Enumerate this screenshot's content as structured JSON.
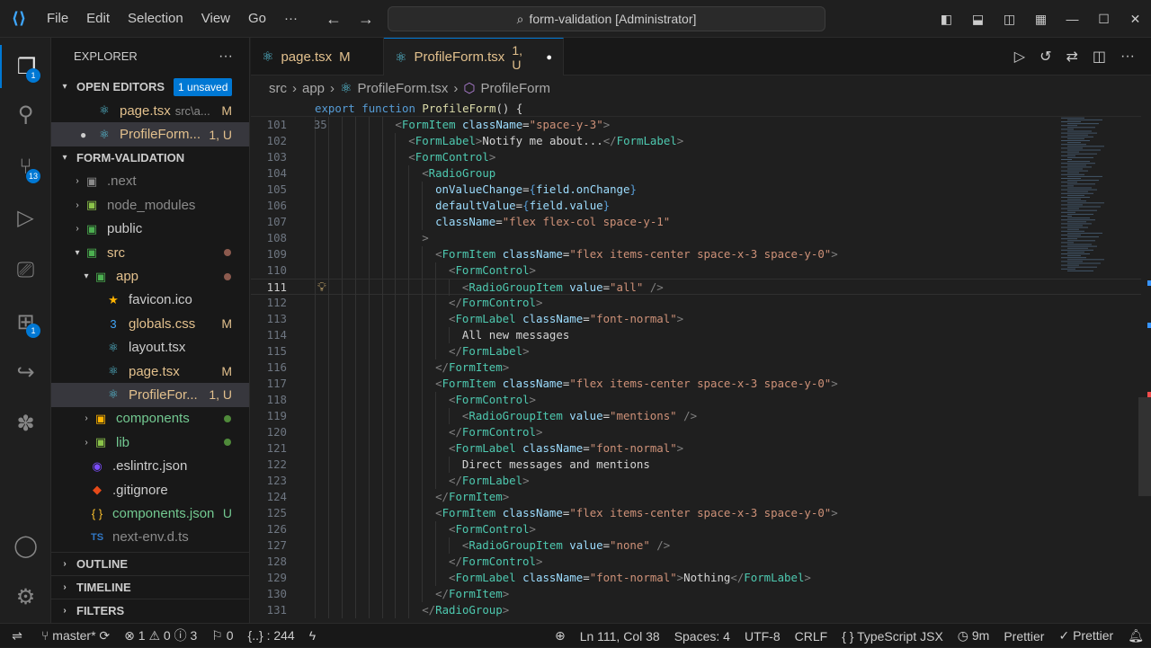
{
  "titlebar": {
    "menu": [
      "File",
      "Edit",
      "Selection",
      "View",
      "Go",
      "···"
    ],
    "search": "form-validation [Administrator]"
  },
  "activity": {
    "explorer_badge": "1",
    "scm_badge": "13",
    "extensions_badge": "1"
  },
  "explorer": {
    "title": "EXPLORER",
    "open_editors": "OPEN EDITORS",
    "unsaved": "1 unsaved",
    "open_files": [
      {
        "name": "page.tsx",
        "path": "src\\a...",
        "status": "M"
      },
      {
        "name": "ProfileForm...",
        "path": "",
        "status": "1, U"
      }
    ],
    "project": "FORM-VALIDATION",
    "tree": [
      {
        "name": ".next",
        "status": ""
      },
      {
        "name": "node_modules",
        "status": ""
      },
      {
        "name": "public",
        "status": ""
      },
      {
        "name": "src",
        "status": ""
      },
      {
        "name": "app",
        "status": ""
      },
      {
        "name": "favicon.ico",
        "status": ""
      },
      {
        "name": "globals.css",
        "status": "M"
      },
      {
        "name": "layout.tsx",
        "status": ""
      },
      {
        "name": "page.tsx",
        "status": "M"
      },
      {
        "name": "ProfileFor...",
        "status": "1, U"
      },
      {
        "name": "components",
        "status": ""
      },
      {
        "name": "lib",
        "status": ""
      },
      {
        "name": ".eslintrc.json",
        "status": ""
      },
      {
        "name": ".gitignore",
        "status": ""
      },
      {
        "name": "components.json",
        "status": "U"
      },
      {
        "name": "next-env.d.ts",
        "status": ""
      }
    ],
    "outline": "OUTLINE",
    "timeline": "TIMELINE",
    "filters": "FILTERS"
  },
  "tabs": [
    {
      "label": "page.tsx",
      "status": "M"
    },
    {
      "label": "ProfileForm.tsx",
      "status": "1, U"
    }
  ],
  "breadcrumb": [
    "src",
    "app",
    "ProfileForm.tsx",
    "ProfileForm"
  ],
  "sticky": {
    "num": "35",
    "code": "export function ProfileForm() {"
  },
  "lines": [
    {
      "n": "101",
      "i": 6,
      "c": "<FormItem className=\"space-y-3\">"
    },
    {
      "n": "102",
      "i": 7,
      "c": "<FormLabel>Notify me about...</FormLabel>"
    },
    {
      "n": "103",
      "i": 7,
      "c": "<FormControl>"
    },
    {
      "n": "104",
      "i": 8,
      "c": "<RadioGroup"
    },
    {
      "n": "105",
      "i": 9,
      "c": "onValueChange={field.onChange}"
    },
    {
      "n": "106",
      "i": 9,
      "c": "defaultValue={field.value}"
    },
    {
      "n": "107",
      "i": 9,
      "c": "className=\"flex flex-col space-y-1\""
    },
    {
      "n": "108",
      "i": 8,
      "c": ">"
    },
    {
      "n": "109",
      "i": 9,
      "c": "<FormItem className=\"flex items-center space-x-3 space-y-0\">"
    },
    {
      "n": "110",
      "i": 10,
      "c": "<FormControl>"
    },
    {
      "n": "111",
      "i": 11,
      "c": "<RadioGroupItem value=\"all\" />"
    },
    {
      "n": "112",
      "i": 10,
      "c": "</FormControl>"
    },
    {
      "n": "113",
      "i": 10,
      "c": "<FormLabel className=\"font-normal\">"
    },
    {
      "n": "114",
      "i": 11,
      "c": "All new messages"
    },
    {
      "n": "115",
      "i": 10,
      "c": "</FormLabel>"
    },
    {
      "n": "116",
      "i": 9,
      "c": "</FormItem>"
    },
    {
      "n": "117",
      "i": 9,
      "c": "<FormItem className=\"flex items-center space-x-3 space-y-0\">"
    },
    {
      "n": "118",
      "i": 10,
      "c": "<FormControl>"
    },
    {
      "n": "119",
      "i": 11,
      "c": "<RadioGroupItem value=\"mentions\" />"
    },
    {
      "n": "120",
      "i": 10,
      "c": "</FormControl>"
    },
    {
      "n": "121",
      "i": 10,
      "c": "<FormLabel className=\"font-normal\">"
    },
    {
      "n": "122",
      "i": 11,
      "c": "Direct messages and mentions"
    },
    {
      "n": "123",
      "i": 10,
      "c": "</FormLabel>"
    },
    {
      "n": "124",
      "i": 9,
      "c": "</FormItem>"
    },
    {
      "n": "125",
      "i": 9,
      "c": "<FormItem className=\"flex items-center space-x-3 space-y-0\">"
    },
    {
      "n": "126",
      "i": 10,
      "c": "<FormControl>"
    },
    {
      "n": "127",
      "i": 11,
      "c": "<RadioGroupItem value=\"none\" />"
    },
    {
      "n": "128",
      "i": 10,
      "c": "</FormControl>"
    },
    {
      "n": "129",
      "i": 10,
      "c": "<FormLabel className=\"font-normal\">Nothing</FormLabel>"
    },
    {
      "n": "130",
      "i": 9,
      "c": "</FormItem>"
    },
    {
      "n": "131",
      "i": 8,
      "c": "</RadioGroup>"
    }
  ],
  "current_line": "111",
  "status": {
    "branch": "master*",
    "errors": "1",
    "warnings": "0",
    "info": "3",
    "ports": "0",
    "selection": "{..} : 244",
    "position": "Ln 111, Col 38",
    "spaces": "Spaces: 4",
    "encoding": "UTF-8",
    "eol": "CRLF",
    "language": "TypeScript JSX",
    "time": "9m",
    "prettier": "Prettier",
    "prettier2": "Prettier"
  },
  "colors": {
    "accent": "#0078d4",
    "modified": "#e2c08d",
    "untracked": "#73c991"
  }
}
